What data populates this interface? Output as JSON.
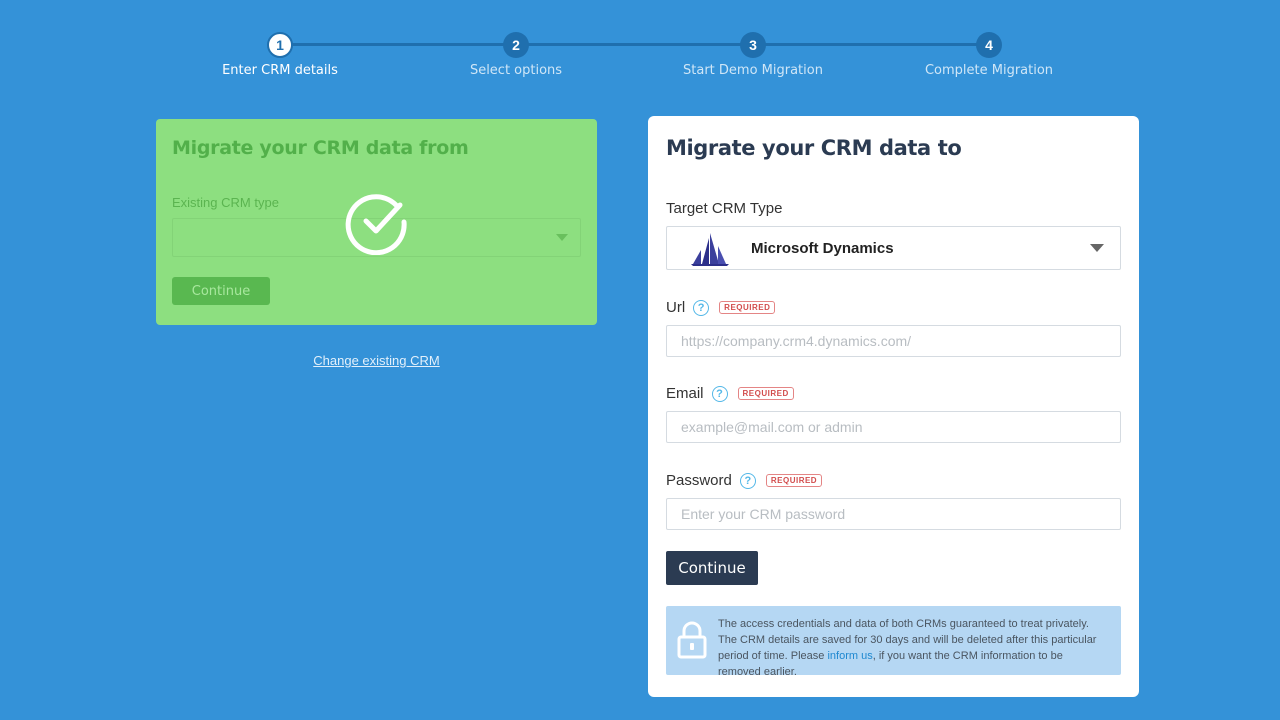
{
  "stepper": {
    "steps": [
      {
        "number": "1",
        "label": "Enter CRM details"
      },
      {
        "number": "2",
        "label": "Select options"
      },
      {
        "number": "3",
        "label": "Start Demo Migration"
      },
      {
        "number": "4",
        "label": "Complete Migration"
      }
    ],
    "active_step": 1
  },
  "source_panel": {
    "title": "Migrate your CRM data from",
    "crm_type_label": "Existing CRM type",
    "crm_type_value": "",
    "continue_label": "Continue",
    "status_icon": "checkmark-circle-icon",
    "change_link": "Change existing CRM"
  },
  "target_panel": {
    "title": "Migrate your CRM data to",
    "crm_type_label": "Target CRM Type",
    "crm_type_value": "Microsoft Dynamics",
    "crm_logo_icon": "microsoft-dynamics-logo-icon",
    "url": {
      "label": "Url",
      "required_badge": "REQUIRED",
      "placeholder": "https://company.crm4.dynamics.com/",
      "value": ""
    },
    "email": {
      "label": "Email",
      "required_badge": "REQUIRED",
      "placeholder": "example@mail.com or admin",
      "value": ""
    },
    "password": {
      "label": "Password",
      "required_badge": "REQUIRED",
      "placeholder": "Enter your CRM password",
      "value": ""
    },
    "continue_label": "Continue",
    "privacy": {
      "text_before": "The access credentials and data of both CRMs guaranteed to treat privately. The CRM details are saved for 30 days and will be deleted after this particular period of time. Please ",
      "link": "inform us",
      "text_after": ", if you want the CRM information to be removed earlier."
    }
  },
  "colors": {
    "background": "#3492d8",
    "stepper_inactive": "#1f6fae",
    "source_panel_bg": "#8ddf80",
    "primary_button": "#2b3b52",
    "privacy_bg": "#b5d7f3",
    "required_badge": "#d24d4d",
    "help_icon": "#54b8e8"
  }
}
